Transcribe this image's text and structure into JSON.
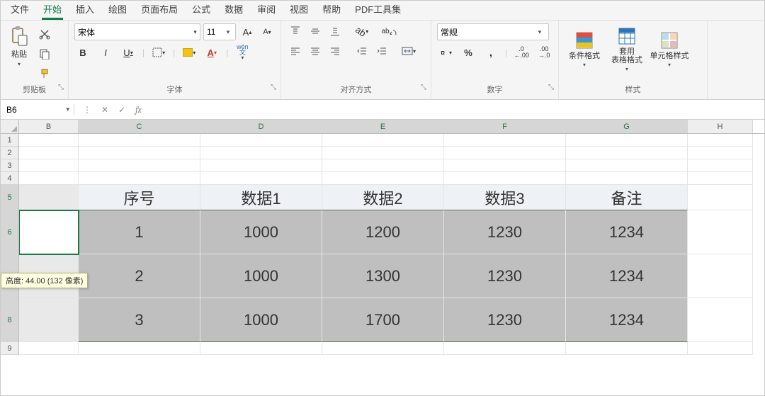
{
  "tabs": [
    "文件",
    "开始",
    "插入",
    "绘图",
    "页面布局",
    "公式",
    "数据",
    "审阅",
    "视图",
    "帮助",
    "PDF工具集"
  ],
  "active_tab": 1,
  "groups": {
    "clipboard": {
      "label": "剪贴板",
      "paste": "粘贴"
    },
    "font": {
      "label": "字体",
      "name": "宋体",
      "size": "11",
      "bold": "B",
      "italic": "I",
      "underline": "U",
      "pinyin": "wén"
    },
    "align": {
      "label": "对齐方式",
      "wrap": "ab"
    },
    "number": {
      "label": "数字",
      "format": "常规",
      "percent": "%",
      "comma": ","
    },
    "styles": {
      "label": "样式",
      "cond": "条件格式",
      "table": "套用\n表格格式",
      "cell": "单元格样式"
    }
  },
  "namebox": "B6",
  "tooltip": "高度: 44.00 (132 像素)",
  "chart_data": {
    "type": "table",
    "columns": [
      "C",
      "D",
      "E",
      "F",
      "G"
    ],
    "header_row": 5,
    "headers": [
      "序号",
      "数据1",
      "数据2",
      "数据3",
      "备注"
    ],
    "rows": [
      {
        "row": 6,
        "values": [
          "1",
          "1000",
          "1200",
          "1230",
          "1234"
        ]
      },
      {
        "row": 7,
        "values": [
          "2",
          "1000",
          "1300",
          "1230",
          "1234"
        ]
      },
      {
        "row": 8,
        "values": [
          "3",
          "1000",
          "1700",
          "1230",
          "1234"
        ]
      }
    ]
  },
  "col_widths": {
    "B": 84,
    "C": 172,
    "D": 172,
    "E": 172,
    "F": 172,
    "G": 172,
    "H": 92
  },
  "row_heights": {
    "1": 18,
    "2": 18,
    "3": 18,
    "4": 18,
    "5": 36,
    "6": 62,
    "7": 62,
    "8": 62,
    "9": 18
  },
  "active_cell": "B6",
  "resize_row": 6
}
